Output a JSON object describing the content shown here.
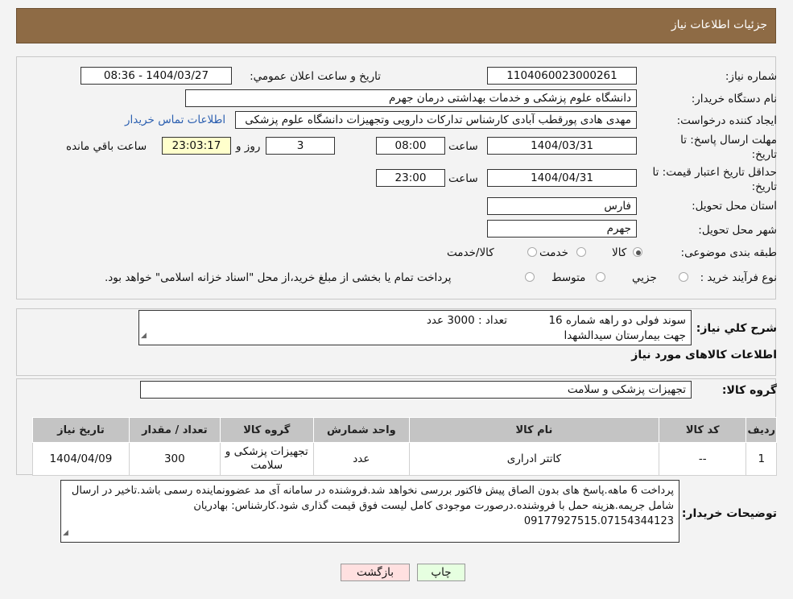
{
  "header": {
    "title": "جزئیات اطلاعات نیاز"
  },
  "form": {
    "need_number_label": "شماره نیاز:",
    "need_number": "1104060023000261",
    "announce_label": "تاریخ و ساعت اعلان عمومي:",
    "announce_value": "1404/03/27 - 08:36",
    "buyer_label": "نام دستگاه خریدار:",
    "buyer": "دانشگاه علوم پزشکی و خدمات بهداشتی  درمان جهرم",
    "creator_label": "ایجاد کننده درخواست:",
    "creator": "مهدی هادی پورقطب آبادی کارشناس تدارکات دارویی وتجهیزات دانشگاه علوم پزشکی",
    "contact_link": "اطلاعات تماس خریدار",
    "deadline_label_1": "مهلت ارسال پاسخ: تا",
    "deadline_label_2": "تاریخ:",
    "deadline_date": "1404/03/31",
    "time_label": "ساعت",
    "deadline_time": "08:00",
    "days": "3",
    "days_label": "روز و",
    "remaining": "23:03:17",
    "remaining_label": "ساعت باقي مانده",
    "validity_label_1": "حداقل تاریخ اعتبار قیمت: تا",
    "validity_label_2": "تاریخ:",
    "validity_date": "1404/04/31",
    "validity_time": "23:00",
    "province_label": "استان محل تحویل:",
    "province": "فارس",
    "city_label": "شهر محل تحویل:",
    "city": "جهرم",
    "category_label": "طبقه بندی موضوعی:",
    "category_options": [
      "کالا",
      "خدمت",
      "کالا/خدمت"
    ],
    "process_label": "نوع فرآیند خرید :",
    "process_options": [
      "جزیي",
      "متوسط"
    ],
    "process_note": "پرداخت تمام یا بخشی از مبلغ خرید،از محل \"اسناد خزانه اسلامی\" خواهد بود."
  },
  "summary": {
    "label": "شرح کلي نیاز:",
    "line1": "سوند فولی دو راهه شماره 16            تعداد : 3000 عدد",
    "line2": "جهت بیمارستان سیدالشهدا"
  },
  "goods": {
    "section_title": "اطلاعات کالاهای مورد نیاز",
    "group_label": "گروه کالا:",
    "group_value": "تجهیزات پزشکی و سلامت"
  },
  "table": {
    "headers": [
      "ردیف",
      "کد کالا",
      "نام کالا",
      "واحد شمارش",
      "گروه کالا",
      "تعداد / مقدار",
      "تاریخ نیاز"
    ],
    "rows": [
      [
        "1",
        "--",
        "کاتتر ادراری",
        "عدد",
        "تجهیزات پزشکی و سلامت",
        "300",
        "1404/04/09"
      ]
    ]
  },
  "buyer_notes": {
    "label": "توضیحات خریدار:",
    "text": "پرداخت 6 ماهه.پاسخ های بدون الصاق پیش فاکتور بررسی نخواهد شد.فروشنده در سامانه آی مد عضوونماینده رسمی باشد.تاخیر در ارسال شامل جریمه.هزینه حمل با فروشنده.درصورت موجودی کامل لیست فوق قیمت گذاری شود.کارشناس: بهادریان 09177927515.07154344123"
  },
  "buttons": {
    "print": "چاپ",
    "back": "بازگشت"
  },
  "colors": {
    "header": "#8e6b45",
    "link": "#2b5fb0",
    "print_btn": "#e6ffe0",
    "back_btn": "#ffe0e0"
  }
}
